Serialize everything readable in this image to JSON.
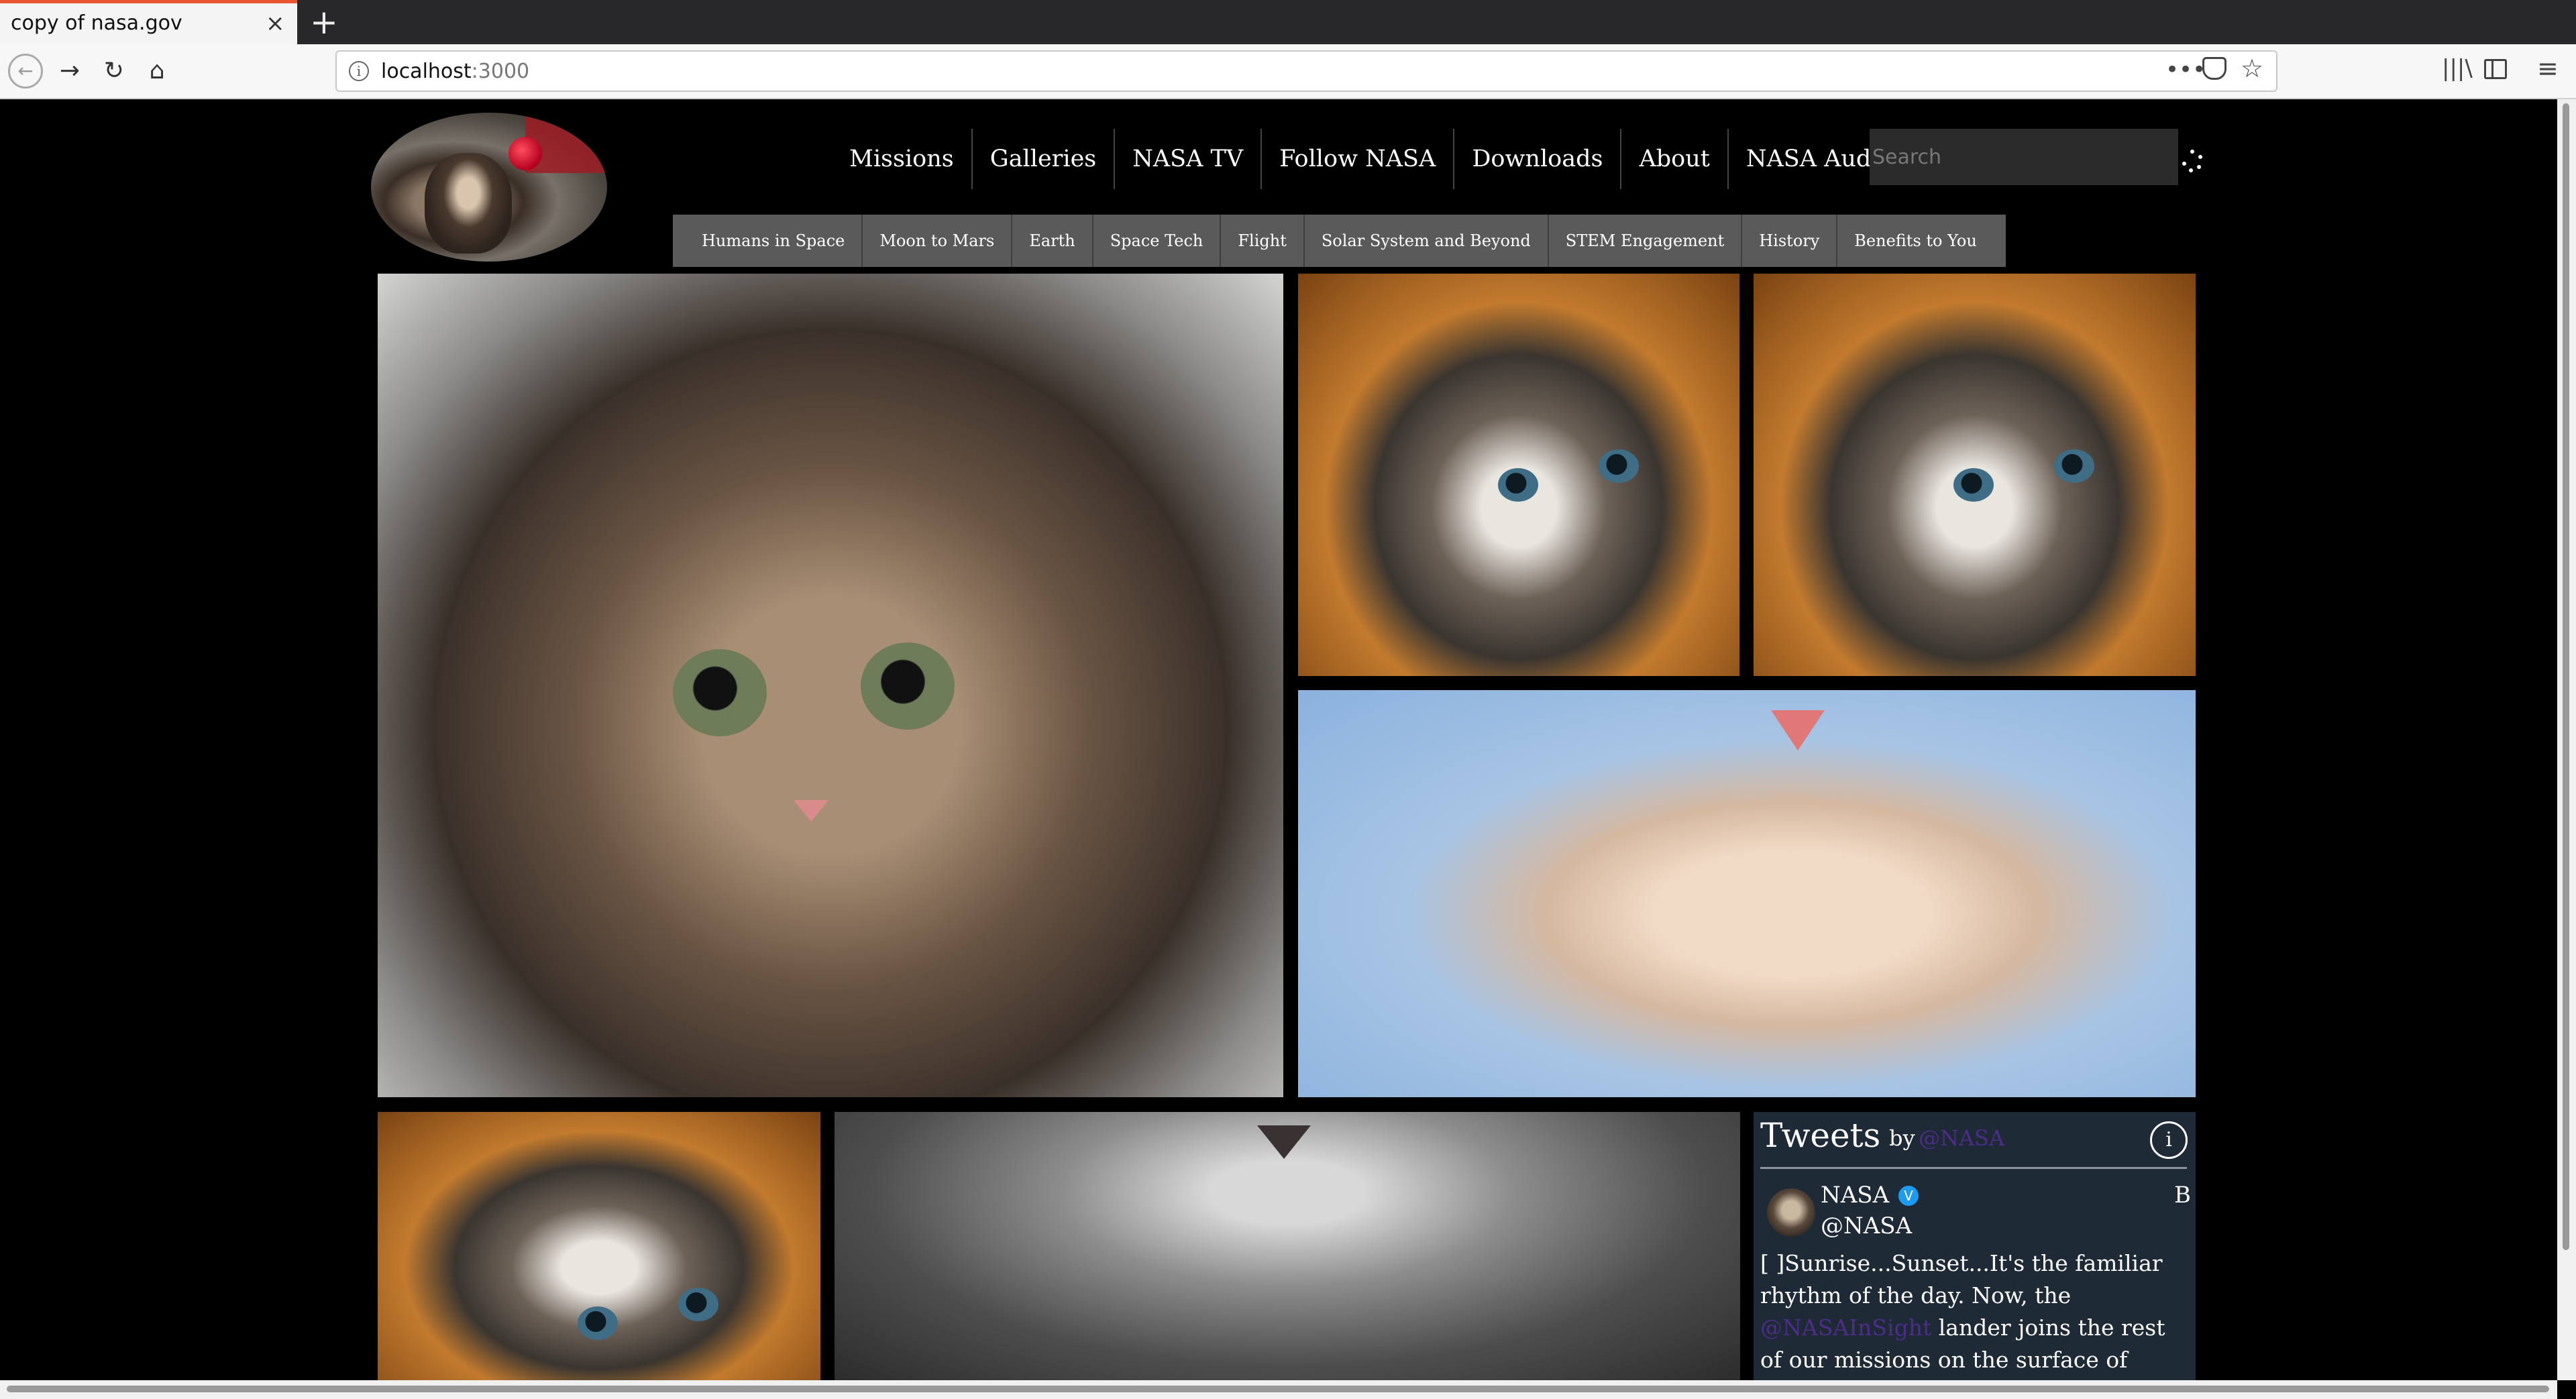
{
  "browser": {
    "tab_title": "copy of nasa.gov",
    "tab_close": "×",
    "new_tab": "+",
    "url_host": "localhost",
    "url_port": ":3000",
    "page_actions": "•••",
    "icons": {
      "back": "←",
      "forward": "→",
      "reload": "↻",
      "home": "⌂",
      "info": "i",
      "star": "☆",
      "library": "|||\\",
      "menu": "≡"
    }
  },
  "header": {
    "main_nav": [
      "Missions",
      "Galleries",
      "NASA TV",
      "Follow NASA",
      "Downloads",
      "About",
      "NASA Audiences"
    ],
    "search_placeholder": "Search",
    "sub_nav": [
      "Humans in Space",
      "Moon to Mars",
      "Earth",
      "Space Tech",
      "Flight",
      "Solar System and Beyond",
      "STEM Engagement",
      "History",
      "Benefits to You"
    ]
  },
  "tweets": {
    "title": "Tweets",
    "by": "by",
    "by_handle": "@NASA",
    "info": "i",
    "author_name": "NASA",
    "verified": "V",
    "brand_letter": "B",
    "author_handle": "@NASA",
    "text_before": "[ ]Sunrise...Sunset...It's the familiar rhythm of the day. Now, the ",
    "mention": "@NASAInSight",
    "text_after": " lander joins the rest of our missions on the surface of Mars in"
  },
  "colors": {
    "accent_tab": "#e8552f",
    "link": "#4d2d88",
    "tweets_bg": "#1e2a36",
    "sub_nav_bg": "#5a5a5a"
  }
}
